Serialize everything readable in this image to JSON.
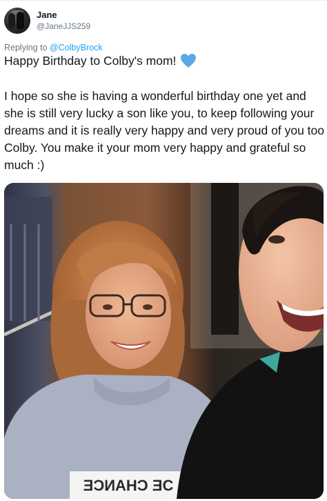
{
  "tweet": {
    "author": {
      "display_name": "Jane",
      "handle": "@JaneJJS259"
    },
    "replying_prefix": "Replying to ",
    "replying_to": "@ColbyBrock",
    "first_line": "Happy Birthday to Colby's mom!",
    "heart_emoji": "blue-heart-icon",
    "body": "I hope so she is having a wonderful birthday one yet and she is still very lucky a son like you, to keep following your dreams and it is really very happy and very proud of you too Colby.  You make it your mom very happy and grateful so much :)",
    "photo_shirt_text": "ƎƆИAHƆ ƎC"
  },
  "colors": {
    "link": "#1da1f2",
    "secondary_text": "#657786",
    "primary_text": "#14171a",
    "heart": "#5aa9e6"
  }
}
